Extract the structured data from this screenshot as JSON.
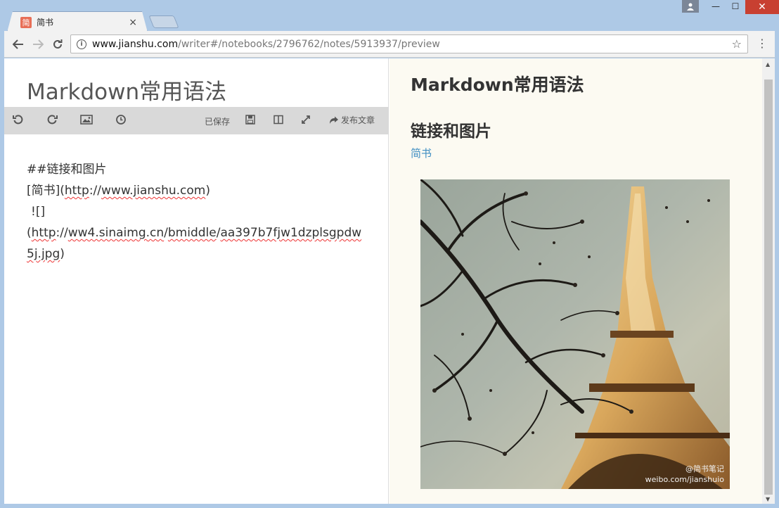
{
  "tab": {
    "favicon": "简",
    "title": "简书",
    "close": "×"
  },
  "window_controls": {
    "minimize": "—",
    "maximize": "☐",
    "close": "✕"
  },
  "address": {
    "host": "www.jianshu.com",
    "path": "/writer#/notebooks/2796762/notes/5913937/preview"
  },
  "editor": {
    "title": "Markdown常用语法",
    "toolbar": {
      "saved": "已保存",
      "publish": "发布文章"
    },
    "lines": {
      "l1": "##链接和图片",
      "l2a": "[简书](",
      "l2b": "http",
      "l2c": ":",
      "l2d": "//",
      "l2e": "www.jianshu.com",
      "l2f": ")",
      "l3": "![]",
      "l4a": "(",
      "l4b": "http",
      "l4c": ":",
      "l4d": "//",
      "l4e": "ww4.sinaimg.cn",
      "l4f": "/",
      "l4g": "bmiddle",
      "l4h": "/",
      "l4i": "aa397b7fjw1dzplsgpdw5j.jpg",
      "l4j": ")"
    }
  },
  "preview": {
    "h1": "Markdown常用语法",
    "h2": "链接和图片",
    "link": "简书",
    "watermark_line1": "@简书笔记",
    "watermark_line2": "weibo.com/jianshuio"
  },
  "colors": {
    "link": "#3f8ec2",
    "preview_bg": "#fcfaf2",
    "titlebar": "#aec9e6",
    "close_red": "#c84031"
  }
}
